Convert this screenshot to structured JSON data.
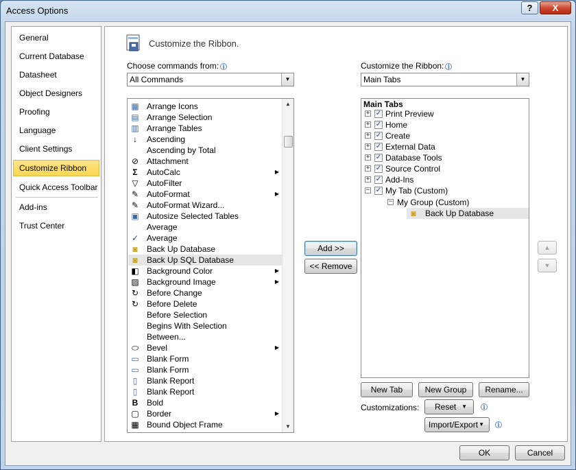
{
  "window": {
    "title": "Access Options",
    "help_glyph": "?",
    "close_glyph": "X"
  },
  "nav": {
    "items": [
      {
        "label": "General"
      },
      {
        "label": "Current Database"
      },
      {
        "label": "Datasheet"
      },
      {
        "label": "Object Designers"
      },
      {
        "label": "Proofing"
      },
      {
        "label": "Language"
      },
      {
        "label": "Client Settings"
      },
      {
        "label": "Customize Ribbon",
        "selected": true
      },
      {
        "label": "Quick Access Toolbar"
      },
      {
        "label": "Add-ins"
      },
      {
        "label": "Trust Center"
      }
    ]
  },
  "header": {
    "title": "Customize the Ribbon."
  },
  "left": {
    "choose_label": "Choose commands from:",
    "choose_value": "All Commands",
    "commands": [
      {
        "label": "Arrange Icons",
        "icon": "arrange-icons-icon"
      },
      {
        "label": "Arrange Selection",
        "icon": "arrange-selection-icon"
      },
      {
        "label": "Arrange Tables",
        "icon": "arrange-tables-icon"
      },
      {
        "label": "Ascending",
        "icon": "sort-ascending-icon"
      },
      {
        "label": "Ascending by Total",
        "icon": ""
      },
      {
        "label": "Attachment",
        "icon": "paperclip-icon"
      },
      {
        "label": "AutoCalc",
        "icon": "sigma-icon",
        "submenu": true
      },
      {
        "label": "AutoFilter",
        "icon": "autofilter-icon"
      },
      {
        "label": "AutoFormat",
        "icon": "autoformat-icon",
        "submenu": true
      },
      {
        "label": "AutoFormat Wizard...",
        "icon": "autoformat-wizard-icon"
      },
      {
        "label": "Autosize Selected Tables",
        "icon": "autosize-icon"
      },
      {
        "label": "Average",
        "icon": ""
      },
      {
        "label": "Average",
        "icon": "checkmark-icon"
      },
      {
        "label": "Back Up Database",
        "icon": "backup-database-icon"
      },
      {
        "label": "Back Up SQL Database",
        "icon": "backup-sql-database-icon",
        "selected": true
      },
      {
        "label": "Background Color",
        "icon": "background-color-icon",
        "submenu": true
      },
      {
        "label": "Background Image",
        "icon": "background-image-icon",
        "submenu": true
      },
      {
        "label": "Before Change",
        "icon": "before-change-icon"
      },
      {
        "label": "Before Delete",
        "icon": "before-delete-icon"
      },
      {
        "label": "Before Selection",
        "icon": ""
      },
      {
        "label": "Begins With Selection",
        "icon": ""
      },
      {
        "label": "Between...",
        "icon": ""
      },
      {
        "label": "Bevel",
        "icon": "bevel-icon",
        "submenu": true
      },
      {
        "label": "Blank Form",
        "icon": "blank-form-icon"
      },
      {
        "label": "Blank Form",
        "icon": "blank-form-2-icon"
      },
      {
        "label": "Blank Report",
        "icon": "blank-report-icon"
      },
      {
        "label": "Blank Report",
        "icon": "blank-report-2-icon"
      },
      {
        "label": "Bold",
        "icon": "bold-icon"
      },
      {
        "label": "Border",
        "icon": "border-icon",
        "submenu": true
      },
      {
        "label": "Bound Object Frame",
        "icon": "bound-object-frame-icon"
      }
    ]
  },
  "middle": {
    "add_label": "Add >>",
    "remove_label": "<< Remove"
  },
  "right": {
    "customize_label": "Customize the Ribbon:",
    "customize_value": "Main Tabs",
    "tree_header": "Main Tabs",
    "tree": [
      {
        "label": "Print Preview",
        "expander": "+",
        "checked": true,
        "level": 0
      },
      {
        "label": "Home",
        "expander": "+",
        "checked": true,
        "level": 0
      },
      {
        "label": "Create",
        "expander": "+",
        "checked": true,
        "level": 0
      },
      {
        "label": "External Data",
        "expander": "+",
        "checked": true,
        "level": 0
      },
      {
        "label": "Database Tools",
        "expander": "+",
        "checked": true,
        "level": 0
      },
      {
        "label": "Source Control",
        "expander": "+",
        "checked": true,
        "level": 0
      },
      {
        "label": "Add-Ins",
        "expander": "+",
        "checked": true,
        "level": 0
      },
      {
        "label": "My Tab (Custom)",
        "expander": "−",
        "checked": true,
        "level": 0
      },
      {
        "label": "My Group (Custom)",
        "expander": "−",
        "level": 1
      },
      {
        "label": "Back Up Database",
        "level": 2,
        "selected": true
      }
    ],
    "new_tab_label": "New Tab",
    "new_group_label": "New Group",
    "rename_label": "Rename...",
    "customizations_label": "Customizations:",
    "reset_label": "Reset",
    "import_export_label": "Import/Export"
  },
  "footer": {
    "ok_label": "OK",
    "cancel_label": "Cancel"
  },
  "colors": {
    "selected_nav": "#fbd750",
    "title_close": "#c9442b",
    "selection_gray": "#e6e6e6"
  }
}
